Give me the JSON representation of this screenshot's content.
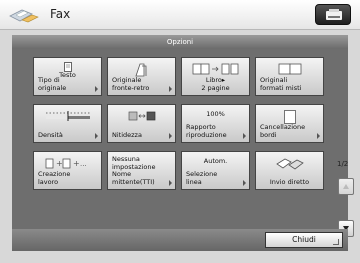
{
  "header": {
    "title": "Fax",
    "device_icon": "copier-icon",
    "fax_icon": "fax-icon"
  },
  "dialog": {
    "title": "Opzioni",
    "close_label": "Chiudi"
  },
  "pager": {
    "page_text": "1/2"
  },
  "tiles": [
    {
      "label": "Tipo di\noriginale",
      "icon_text": "Testo",
      "icon": "text-doc-icon"
    },
    {
      "label": "Originale\nfronte-retro",
      "icon": "two-sided-original-icon"
    },
    {
      "label": "Libro▸\n2 pagine",
      "icon": "book-to-two-pages-icon"
    },
    {
      "label": "Originali\nformati misti",
      "icon": "mixed-size-originals-icon"
    },
    {
      "label": "Densità",
      "icon": "density-slider-icon"
    },
    {
      "label": "Nitidezza",
      "icon": "sharpness-icon"
    },
    {
      "label": "Rapporto\nriproduzione",
      "icon_text": "100%"
    },
    {
      "label": "Cancellazione\nbordi",
      "icon": "erase-frame-icon"
    },
    {
      "label": "Creazione\nlavoro",
      "icon": "job-build-icon"
    },
    {
      "label": "Nome\nmittente(TTI)",
      "icon_text": "Nessuna\nimpostazione"
    },
    {
      "label": "Selezione\nlinea",
      "icon_text": "Autom."
    },
    {
      "label": "Invio diretto",
      "icon": "direct-send-icon"
    }
  ]
}
